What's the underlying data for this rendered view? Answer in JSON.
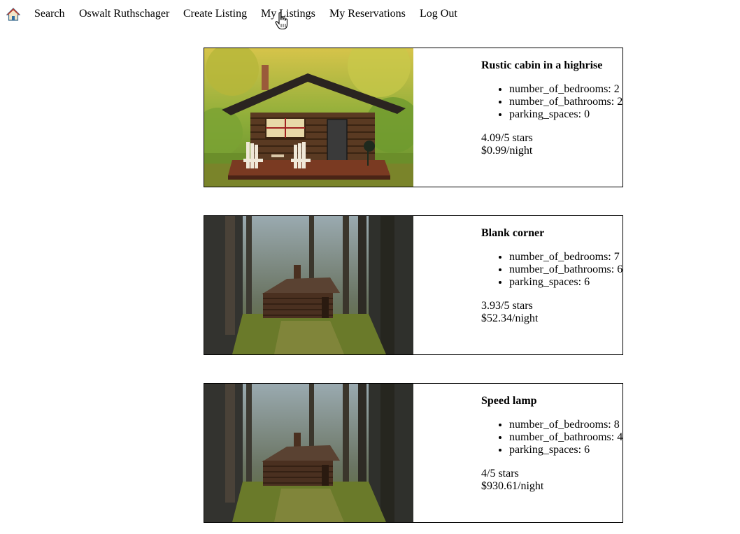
{
  "nav": {
    "home_icon": "house-icon",
    "links": [
      {
        "label": "Search"
      },
      {
        "label": "Oswalt Ruthschager"
      },
      {
        "label": "Create Listing"
      },
      {
        "label": "My Listings"
      },
      {
        "label": "My Reservations"
      },
      {
        "label": "Log Out"
      }
    ]
  },
  "listings": [
    {
      "title": "Rustic cabin in a highrise",
      "image": "cabin-photo-sunny",
      "details": [
        "number_of_bedrooms: 2",
        "number_of_bathrooms: 2",
        "parking_spaces: 0"
      ],
      "rating": "4.09/5 stars",
      "price": "$0.99/night"
    },
    {
      "title": "Blank corner",
      "image": "cabin-photo-forest",
      "details": [
        "number_of_bedrooms: 7",
        "number_of_bathrooms: 6",
        "parking_spaces: 6"
      ],
      "rating": "3.93/5 stars",
      "price": "$52.34/night"
    },
    {
      "title": "Speed lamp",
      "image": "cabin-photo-forest",
      "details": [
        "number_of_bedrooms: 8",
        "number_of_bathrooms: 4",
        "parking_spaces: 6"
      ],
      "rating": "4/5 stars",
      "price": "$930.61/night"
    }
  ]
}
